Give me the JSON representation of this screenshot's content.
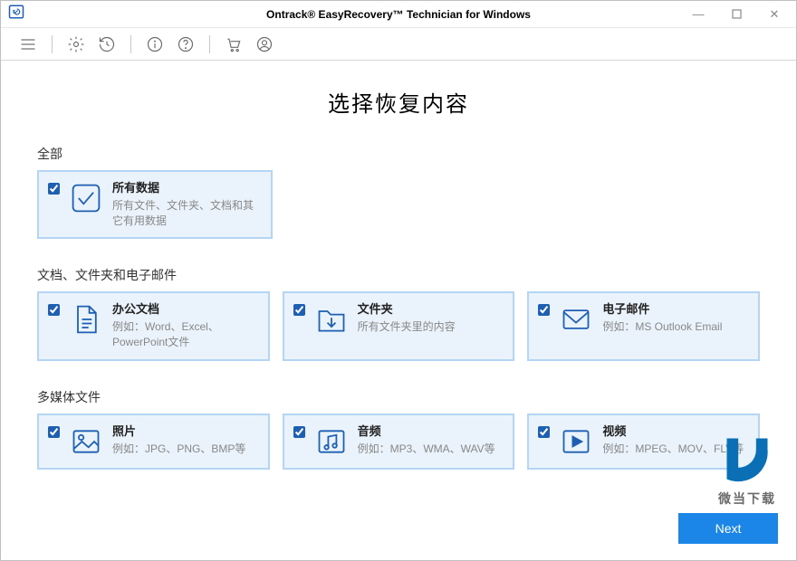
{
  "window": {
    "title": "Ontrack® EasyRecovery™ Technician for Windows"
  },
  "page": {
    "title": "选择恢复内容"
  },
  "sections": {
    "all": {
      "title": "全部",
      "card_title": "所有数据",
      "card_desc": "所有文件、文件夹、文档和其它有用数据"
    },
    "docs": {
      "title": "文档、文件夹和电子邮件",
      "office_title": "办公文档",
      "office_desc": "例如：Word、Excel、PowerPoint文件",
      "folders_title": "文件夹",
      "folders_desc": "所有文件夹里的内容",
      "email_title": "电子邮件",
      "email_desc": "例如：MS Outlook Email"
    },
    "media": {
      "title": "多媒体文件",
      "photo_title": "照片",
      "photo_desc": "例如：JPG、PNG、BMP等",
      "audio_title": "音频",
      "audio_desc": "例如：MP3、WMA、WAV等",
      "video_title": "视频",
      "video_desc": "例如：MPEG、MOV、FLV等"
    }
  },
  "buttons": {
    "next": "Next"
  },
  "watermark": "微当下载",
  "colors": {
    "accent": "#1b86e7",
    "card_border": "#b4d6f4",
    "card_bg": "#eaf3fb",
    "icon": "#1e5fb4"
  }
}
